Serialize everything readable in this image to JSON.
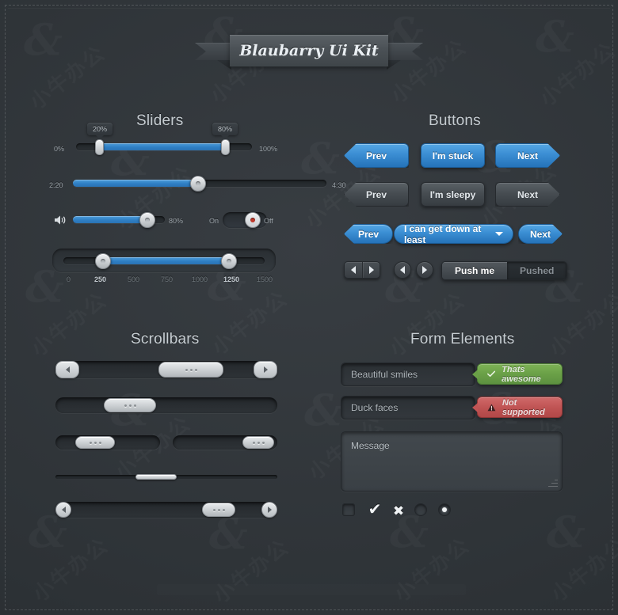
{
  "banner": {
    "title": "Blaubarry Ui Kit"
  },
  "sections": {
    "sliders": "Sliders",
    "buttons": "Buttons",
    "scrollbars": "Scrollbars",
    "form": "Form Elements"
  },
  "sliders": {
    "range_percent": {
      "min_label": "0%",
      "max_label": "100%",
      "low_bubble": "20%",
      "high_bubble": "80%",
      "low_value": 20,
      "high_value": 80
    },
    "time": {
      "min_label": "2:20",
      "max_label": "4:30",
      "value": 72
    },
    "volume": {
      "icon": "speaker-icon",
      "value_label": "80%",
      "value": 80
    },
    "toggle": {
      "on_label": "On",
      "off_label": "Off",
      "state": "off"
    },
    "ticked_range": {
      "ticks": [
        "0",
        "250",
        "500",
        "750",
        "1000",
        "1250",
        "1500"
      ],
      "active_ticks": [
        "250",
        "1250"
      ],
      "low_value": 250,
      "high_value": 1250
    }
  },
  "buttons": {
    "row1": [
      {
        "label": "Prev",
        "style": "blue",
        "shape": "prev"
      },
      {
        "label": "I'm stuck",
        "style": "blue",
        "shape": "round"
      },
      {
        "label": "Next",
        "style": "blue",
        "shape": "next"
      }
    ],
    "row2": [
      {
        "label": "Prev",
        "style": "gray",
        "shape": "prev"
      },
      {
        "label": "I'm sleepy",
        "style": "gray",
        "shape": "round"
      },
      {
        "label": "Next",
        "style": "gray",
        "shape": "next"
      }
    ],
    "row3": [
      {
        "label": "Prev",
        "style": "blue",
        "shape": "pill-prev"
      },
      {
        "label": "I can get down at least",
        "style": "blue",
        "shape": "pill",
        "dropdown": true
      },
      {
        "label": "Next",
        "style": "blue",
        "shape": "pill-next"
      }
    ],
    "steppers": {
      "segmented": [
        "prev-arrow-icon",
        "next-arrow-icon"
      ],
      "circular": [
        "prev-arrow-icon",
        "next-arrow-icon"
      ]
    },
    "push_toggle": {
      "active_label": "Push me",
      "inactive_label": "Pushed"
    }
  },
  "scrollbars": {
    "bar1": {
      "thumb_dots": 3,
      "has_arrows": true
    },
    "bar2": {
      "thumb_dots": 3,
      "has_arrows": false
    },
    "bar3_left": {
      "thumb_dots": 3
    },
    "bar3_right": {
      "thumb_dots": 3
    },
    "bar4_thin": {},
    "bar5": {
      "thumb_dots": 3,
      "has_arrows": true
    }
  },
  "form": {
    "input1": {
      "value": "Beautiful smiles"
    },
    "input2": {
      "value": "Duck faces"
    },
    "textarea": {
      "placeholder": "Message"
    },
    "validation_success": {
      "text": "Thats awesome",
      "icon": "check-icon",
      "color": "#6aa047"
    },
    "validation_error": {
      "text": "Not supported",
      "icon": "warning-icon",
      "color": "#c05454"
    },
    "controls": [
      {
        "name": "checkbox-empty",
        "kind": "square"
      },
      {
        "name": "checkbox-checked",
        "kind": "check",
        "glyph": "✔"
      },
      {
        "name": "checkbox-cross",
        "kind": "cross",
        "glyph": "✖"
      },
      {
        "name": "radio-empty",
        "kind": "circle"
      },
      {
        "name": "radio-selected",
        "kind": "radio"
      }
    ]
  },
  "theme": {
    "background": "#2f3438",
    "accent_blue": "#3c8fd4",
    "success_green": "#6aa047",
    "error_red": "#c05454",
    "heading_color": "#c6cdd2"
  }
}
